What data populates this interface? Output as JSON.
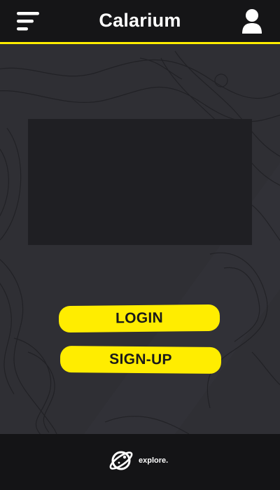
{
  "header": {
    "title": "Calarium",
    "menu_icon": "menu-icon",
    "profile_icon": "user-icon"
  },
  "main": {
    "media_panel": "",
    "login_label": "LOGIN",
    "signup_label": "SIGN-UP"
  },
  "footer": {
    "brand_icon": "planet-icon",
    "brand_label": "explore."
  },
  "colors": {
    "accent": "#FFED00",
    "header_bg": "#151517",
    "main_bg": "#2f2f34",
    "panel_bg": "#1f1f23",
    "footer_bg": "#141416",
    "text": "#ffffff"
  }
}
